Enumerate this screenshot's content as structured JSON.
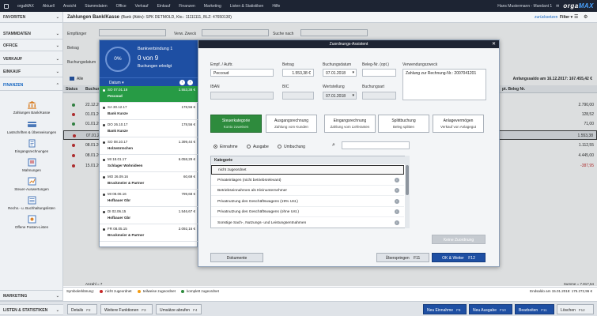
{
  "topbar": {
    "nav": [
      "orgaMAX",
      "Aktuell",
      "Ansicht",
      "Stammdaten",
      "Office",
      "Verkauf",
      "Einkauf",
      "Finanzen",
      "Marketing",
      "Listen & Statistiken",
      "Hilfe"
    ],
    "user": "Hans Mustermann - Mandant 1",
    "brand_a": "orga",
    "brand_b": "MAX"
  },
  "sidebar": {
    "sections": [
      "FAVORITEN",
      "STAMMDATEN",
      "OFFICE",
      "VERKAUF",
      "EINKAUF",
      "FINANZEN"
    ],
    "items": [
      "Zahlungen Bank/Kasse",
      "Lastschriften & Überweisungen",
      "Eingangsrechnungen",
      "Mahnungen",
      "Steuer-Auswertungen",
      "Rechn.- u. Buchhaltungslisten",
      "Offene Posten-Listen"
    ],
    "bottom": [
      "MARKETING",
      "LISTEN & STATISTIKEN"
    ]
  },
  "header": {
    "title": "Zahlungen Bank/Kasse",
    "bank": "(Bank (Aktiv): SPK DETMOLD, Kto.: 11111111, BLZ: 47650130)",
    "reset": "zurücksetzen",
    "filter": "Filter"
  },
  "filters": {
    "empfaenger": "Empfänger",
    "zweck": "Verw. Zweck",
    "suche": "Suche nach",
    "betrag": "Betrag",
    "buchungsdatum": "Buchungsdatum"
  },
  "toolbar": {
    "alle": "Alle",
    "anfangssaldo": "Anfangssaldo am 16.12.2017: 167.455,42 €"
  },
  "grid": {
    "col_status": "Status",
    "col_buchung": "Buchun",
    "col_beleg": "pt. Beleg Nr.",
    "rows": [
      {
        "status": "green",
        "date": "22.12.20"
      },
      {
        "status": "red",
        "date": "01.01.20"
      },
      {
        "status": "green",
        "date": "01.01.20"
      },
      {
        "status": "red",
        "date": "07.01.20"
      },
      {
        "status": "red",
        "date": "08.01.20"
      },
      {
        "status": "red",
        "date": "08.01.20"
      },
      {
        "status": "red",
        "date": "15.01.20"
      }
    ],
    "amounts": [
      "2.790,00",
      "128,52",
      "71,00",
      "1.553,38",
      "1.112,55",
      "4.445,00",
      "-387,95"
    ],
    "anzahl": "Anzahl = 7",
    "summe": "Summe = 7.817,54",
    "endsaldo": "Endsaldo am 15.01.2018: 175.272,96 €"
  },
  "legend": {
    "label": "Symbolerklärung:",
    "red": "nicht zugeordnet",
    "orange": "teilweise zugeordnet",
    "green": "komplett zugeordnet"
  },
  "bottombar": {
    "details": "Details",
    "details_key": "F2",
    "weitere": "Weitere Funktionen",
    "weitere_key": "F3",
    "umsaetze": "Umsätze abrufen",
    "umsaetze_key": "F4",
    "neu_einnahme": "Neu Einnahme",
    "neu_einnahme_key": "F9",
    "neu_ausgabe": "Neu Ausgabe",
    "neu_ausgabe_key": "F10",
    "bearbeiten": "Bearbeiten",
    "bearbeiten_key": "F11",
    "loeschen": "Löschen",
    "loeschen_key": "F12"
  },
  "progress": {
    "percent": "0%",
    "title": "Bankverbindung 1",
    "count": "0 von 9",
    "sub": "Buchungen erledigt",
    "sort": "Datum",
    "items": [
      {
        "date": "SO 07.01.18",
        "amount": "1.553,38 €",
        "name": "Peccoud",
        "selected": true
      },
      {
        "date": "SA 30.12.17",
        "amount": "178,56 €",
        "name": "Bank Kunze",
        "selected": false
      },
      {
        "date": "DO 26.10.17",
        "amount": "178,56 €",
        "name": "Bank Kunze",
        "selected": false
      },
      {
        "date": "SO 08.10.17",
        "amount": "1.399,44 €",
        "name": "Holzwürmchen",
        "selected": false
      },
      {
        "date": "MI 18.01.17",
        "amount": "6.058,29 €",
        "name": "Schlager Wohnideen",
        "selected": false
      },
      {
        "date": "MO 26.09.16",
        "amount": "60,69 €",
        "name": "Bruckmeier & Partner",
        "selected": false
      },
      {
        "date": "MI 08.06.16",
        "amount": "799,68 €",
        "name": "Hofbauer Gbr",
        "selected": false
      },
      {
        "date": "DI 02.06.15",
        "amount": "1.546,67 €",
        "name": "Hofbauer Gbr",
        "selected": false
      },
      {
        "date": "FR 08.05.15",
        "amount": "2.092,16 €",
        "name": "Bruckmeier & Partner",
        "selected": false
      }
    ]
  },
  "dialog": {
    "title": "Zuordnungs-Assistent",
    "empf_label": "Empf. / Auftr.",
    "empf_value": "Peccoud",
    "betrag_label": "Betrag",
    "betrag_value": "1.553,38 €",
    "buchungsdatum_label": "Buchungsdatum",
    "buchungsdatum_value": "07.01.2018",
    "belegnr_label": "Beleg-Nr. (opt.)",
    "zweck_label": "Verwendungszweck",
    "zweck_value": "Zahlung zur Rechnung-Nr.: 2007041201",
    "iban_label": "IBAN",
    "bic_label": "BIC",
    "wertstellung_label": "Wertstellung",
    "wertstellung_value": "07.01.2018",
    "buchungsart_label": "Buchungsart",
    "cat_buttons": [
      {
        "label": "Steuerkategorie",
        "sub": "Konto zuweisen",
        "active": true
      },
      {
        "label": "Ausgangsrechnung",
        "sub": "Zahlung vom Kunden",
        "active": false
      },
      {
        "label": "Eingangsrechnung",
        "sub": "Zahlung vom Lieferanten",
        "active": false
      },
      {
        "label": "Splittbuchung",
        "sub": "Beleg splitten",
        "active": false
      },
      {
        "label": "Anlagevermögen",
        "sub": "Verkauf von Anlagegut",
        "active": false
      }
    ],
    "radio_einnahme": "Einnahme",
    "radio_ausgabe": "Ausgabe",
    "radio_umbuchung": "Umbuchung",
    "kategorie_header": "Kategorie",
    "categories": [
      "nicht zugeordnet",
      "Privateinlagen  (nicht betriebsrelevant)",
      "Betriebseinnahmen als Kleinunternehmer",
      "Privatnutzung des Geschäftswagens (19% Ust.)",
      "Privatnutzung des Geschäftswagens (ohne Ust.)",
      "Sonstige Sach-, Nutzungs- und Leistungsentnahmen"
    ],
    "keine_zuordnung": "Keine Zuordnung",
    "dokumente": "Dokumente",
    "ueberspringen": "Überspringen",
    "ueberspringen_key": "F11",
    "ok_weiter": "OK & Weiter",
    "ok_weiter_key": "F12"
  },
  "colors": {
    "accent": "#1e4fa3",
    "success": "#279b45",
    "danger": "#c62828",
    "topbar": "#1d2433"
  }
}
